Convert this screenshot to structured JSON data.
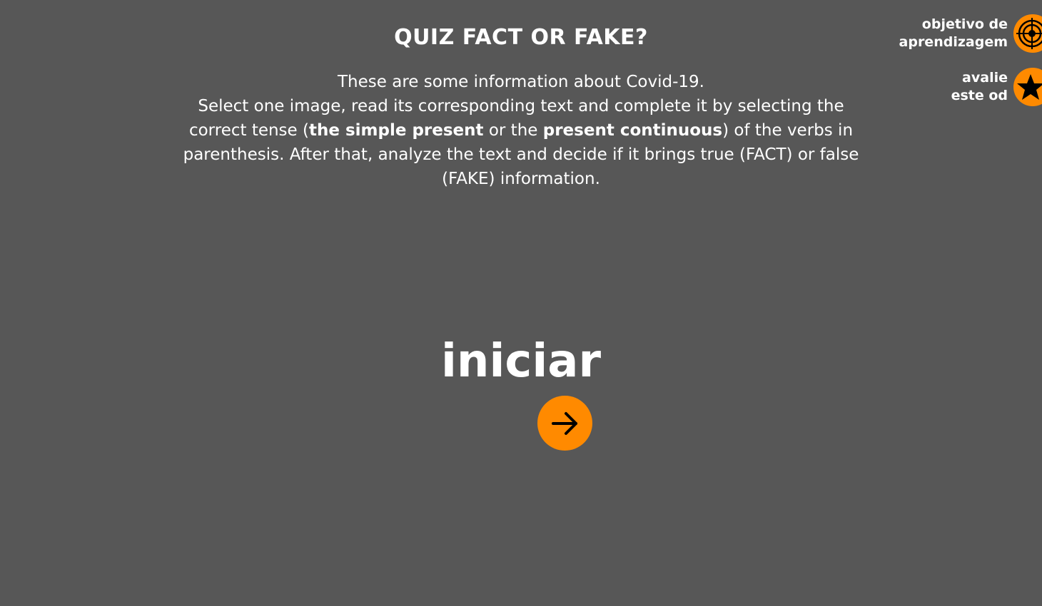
{
  "header": {
    "title": "QUIZ FACT OR FAKE?"
  },
  "instructions": {
    "line1": "These are some information about Covid-19.",
    "line2": "Select one image, read its corresponding text and complete it by selecting the",
    "line3_a": "correct tense (",
    "line3_b": "the simple present",
    "line3_c": " or the ",
    "line3_d": "present continuous",
    "line3_e": ") of the verbs in",
    "line4": "parenthesis. After that, analyze the text and decide if it brings true (FACT) or false",
    "line5": "(FAKE) information."
  },
  "side_tools": {
    "objective": {
      "line1": "objetivo de",
      "line2": "aprendizagem",
      "icon": "target-icon"
    },
    "evaluate": {
      "line1": "avalie",
      "line2": "este od",
      "icon": "star-icon"
    }
  },
  "start": {
    "label": "iniciar",
    "icon": "arrow-right-icon"
  },
  "colors": {
    "background": "#575757",
    "accent": "#ff8a00",
    "text": "#ffffff"
  }
}
